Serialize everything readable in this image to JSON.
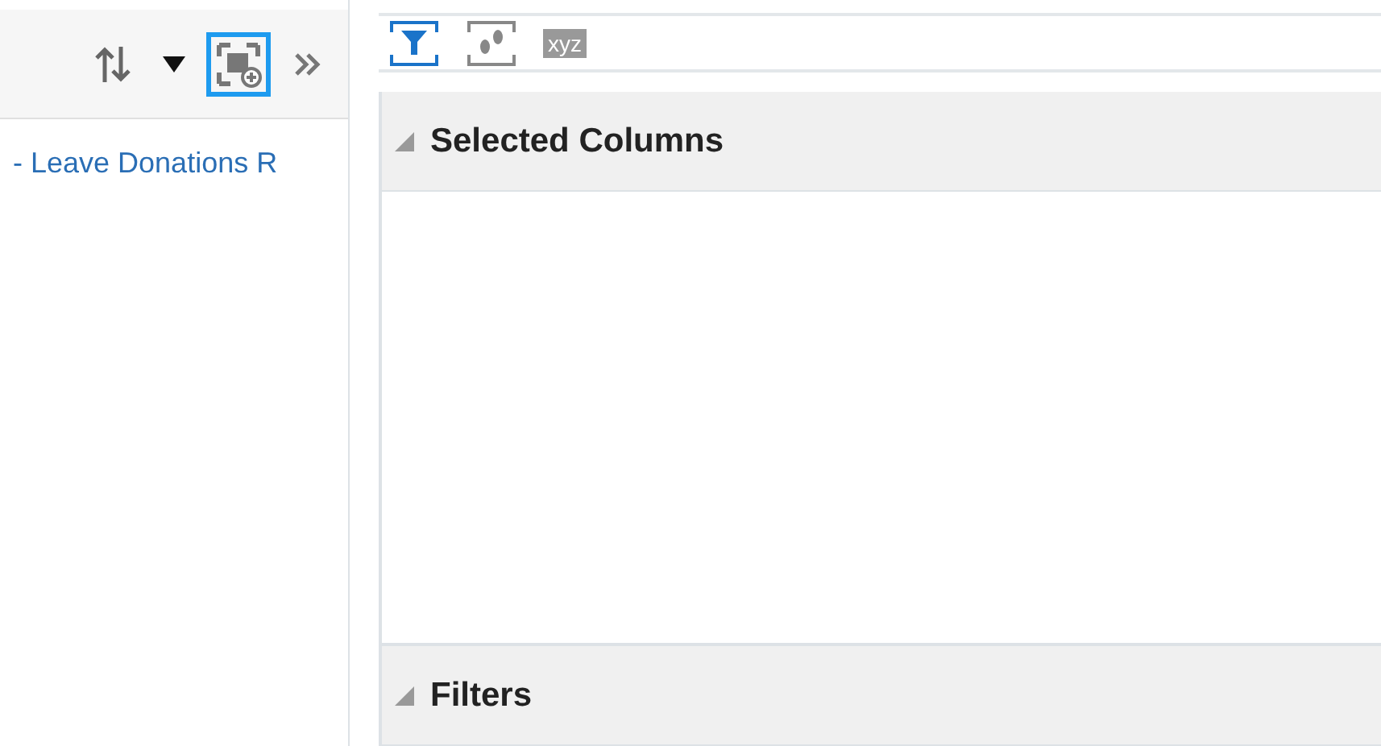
{
  "left_toolbar": {
    "tools": [
      {
        "kind": "sort",
        "selected": false
      },
      {
        "kind": "dropdown",
        "selected": false
      },
      {
        "kind": "add-view",
        "selected": true
      },
      {
        "kind": "expand",
        "selected": false
      }
    ]
  },
  "left_panel": {
    "items": [
      {
        "label": "- Leave Donations R"
      }
    ]
  },
  "right_toolbar": {
    "tools": [
      {
        "kind": "filter",
        "on": true
      },
      {
        "kind": "steps",
        "on": false
      },
      {
        "kind": "xyz",
        "label": "xyz",
        "on": false
      }
    ]
  },
  "sections": [
    {
      "title": "Selected Columns",
      "expanded": true
    },
    {
      "title": "Filters",
      "expanded": true
    }
  ]
}
